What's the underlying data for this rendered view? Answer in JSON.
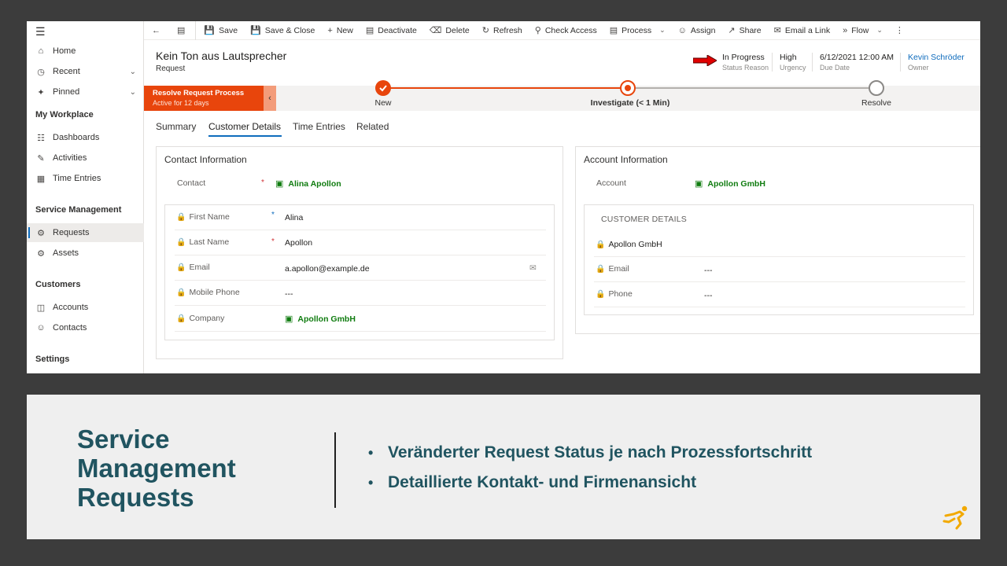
{
  "sidebar": {
    "home": "Home",
    "recent": "Recent",
    "pinned": "Pinned",
    "group_workplace": "My Workplace",
    "dashboards": "Dashboards",
    "activities": "Activities",
    "time_entries": "Time Entries",
    "group_service": "Service Management",
    "requests": "Requests",
    "assets": "Assets",
    "group_customers": "Customers",
    "accounts": "Accounts",
    "contacts": "Contacts",
    "group_settings": "Settings"
  },
  "commandbar": {
    "save": "Save",
    "save_close": "Save & Close",
    "new": "New",
    "deactivate": "Deactivate",
    "delete": "Delete",
    "refresh": "Refresh",
    "check_access": "Check Access",
    "process": "Process",
    "assign": "Assign",
    "share": "Share",
    "email_link": "Email a Link",
    "flow": "Flow"
  },
  "header": {
    "title": "Kein Ton aus Lautsprecher",
    "entity": "Request",
    "status_value": "In Progress",
    "status_label": "Status Reason",
    "urgency_value": "High",
    "urgency_label": "Urgency",
    "due_value": "6/12/2021 12:00 AM",
    "due_label": "Due Date",
    "owner_value": "Kevin Schröder",
    "owner_label": "Owner"
  },
  "bpf": {
    "name": "Resolve Request Process",
    "duration": "Active for 12 days",
    "stages": [
      {
        "label": "New",
        "state": "completed"
      },
      {
        "label": "Investigate  (< 1 Min)",
        "state": "active"
      },
      {
        "label": "Resolve",
        "state": "pending"
      }
    ],
    "accent_color": "#e8450c"
  },
  "tabs": [
    "Summary",
    "Customer Details",
    "Time Entries",
    "Related"
  ],
  "active_tab": "Customer Details",
  "contact_card": {
    "title": "Contact Information",
    "contact_label": "Contact",
    "contact_value": "Alina Apollon",
    "fields": [
      {
        "label": "First Name",
        "value": "Alina",
        "required": true
      },
      {
        "label": "Last Name",
        "value": "Apollon",
        "required": true
      },
      {
        "label": "Email",
        "value": "a.apollon@example.de"
      },
      {
        "label": "Mobile Phone",
        "value": "---"
      },
      {
        "label": "Company",
        "value": "Apollon GmbH"
      }
    ]
  },
  "account_card": {
    "title": "Account Information",
    "account_label": "Account",
    "account_value": "Apollon GmbH",
    "section_title": "CUSTOMER DETAILS",
    "company": "Apollon GmbH",
    "fields": [
      {
        "label": "Email",
        "value": "---"
      },
      {
        "label": "Phone",
        "value": "---"
      }
    ]
  },
  "banner": {
    "title_lines": [
      "Service",
      "Management",
      "Requests"
    ],
    "bullets": [
      "Veränderter Request Status je nach Prozessfortschritt",
      "Detaillierte Kontakt- und Firmenansicht"
    ]
  },
  "icons": {
    "hamburger": "menu-icon",
    "lookup_contact": "contact-icon",
    "lookup_account": "account-icon",
    "field_lock": "lock-icon",
    "email_compose": "email-icon",
    "status_pointer": "red-arrow-icon",
    "brand_logo": "runner-logo"
  }
}
